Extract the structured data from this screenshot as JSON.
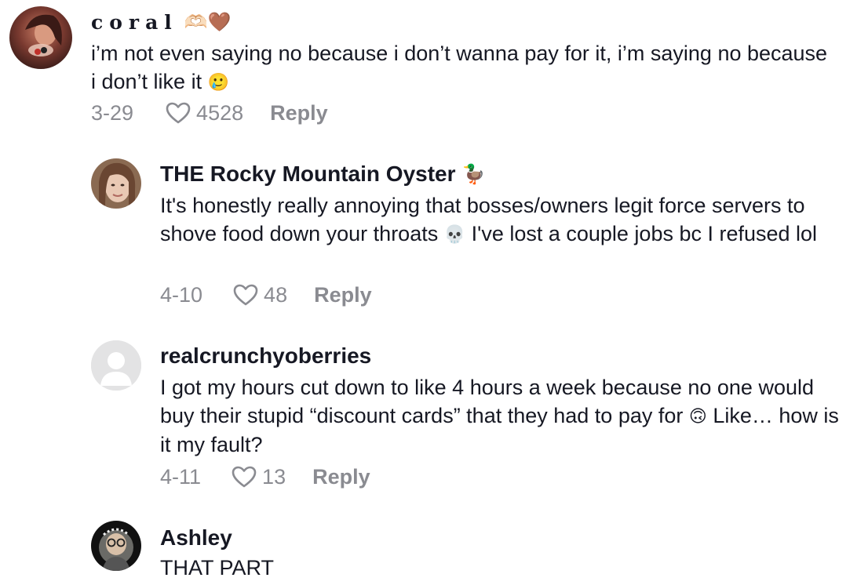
{
  "comments": [
    {
      "username": "coral",
      "username_emoji": "🫶🏻🤎",
      "text": "i’m not even saying no because i don’t wanna pay for it, i’m saying no because i don’t like it",
      "text_emoji": "🥲",
      "date": "3-29",
      "likes": "4528",
      "reply_label": "Reply"
    },
    {
      "username": "THE Rocky Mountain Oyster",
      "username_emoji": "🦆",
      "text_part1": "It's honestly really annoying that bosses/owners legit force servers to shove food down your throats",
      "text_emoji": "💀",
      "text_part2": "I've lost a couple jobs bc I refused lol",
      "date": "4-10",
      "likes": "48",
      "reply_label": "Reply"
    },
    {
      "username": "realcrunchyoberries",
      "text": "I got my hours cut down to like 4 hours a week because no one would buy their stupid “discount cards” that they had to pay for",
      "text_emoji": "🙃",
      "text_part2": "Like… how is it my fault?",
      "date": "4-11",
      "likes": "13",
      "reply_label": "Reply"
    },
    {
      "username": "Ashley",
      "text": "THAT PART"
    }
  ],
  "colors": {
    "primary_text": "#161823",
    "secondary_text": "#8a8b91",
    "background": "#ffffff"
  }
}
